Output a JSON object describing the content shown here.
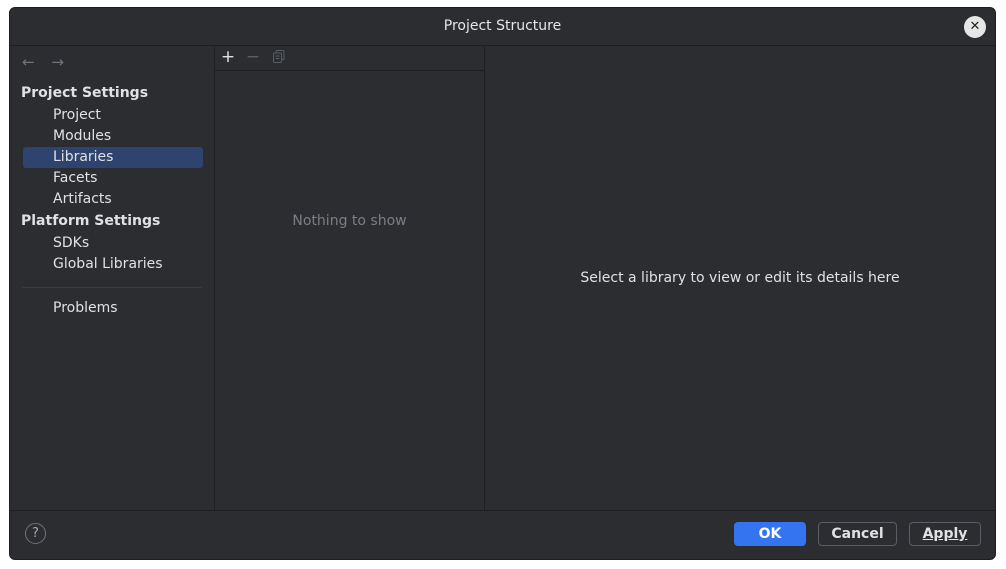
{
  "window": {
    "title": "Project Structure",
    "close_glyph": "✕"
  },
  "sidebar": {
    "back_glyph": "←",
    "forward_glyph": "→",
    "project_settings_header": "Project Settings",
    "project_items": [
      {
        "label": "Project"
      },
      {
        "label": "Modules"
      },
      {
        "label": "Libraries",
        "selected": true
      },
      {
        "label": "Facets"
      },
      {
        "label": "Artifacts"
      }
    ],
    "platform_settings_header": "Platform Settings",
    "platform_items": [
      {
        "label": "SDKs"
      },
      {
        "label": "Global Libraries"
      }
    ],
    "problems_label": "Problems"
  },
  "list_panel": {
    "add_glyph": "+",
    "remove_glyph": "−",
    "copy_icon": "copy-icon",
    "empty_text": "Nothing to show"
  },
  "detail_panel": {
    "placeholder": "Select a library to view or edit its details here"
  },
  "footer": {
    "help_glyph": "?",
    "ok_label": "OK",
    "cancel_label": "Cancel",
    "apply_label": "Apply"
  },
  "colors": {
    "background": "#2b2d30",
    "selection": "#2e436e",
    "primary_button": "#3574f0"
  }
}
